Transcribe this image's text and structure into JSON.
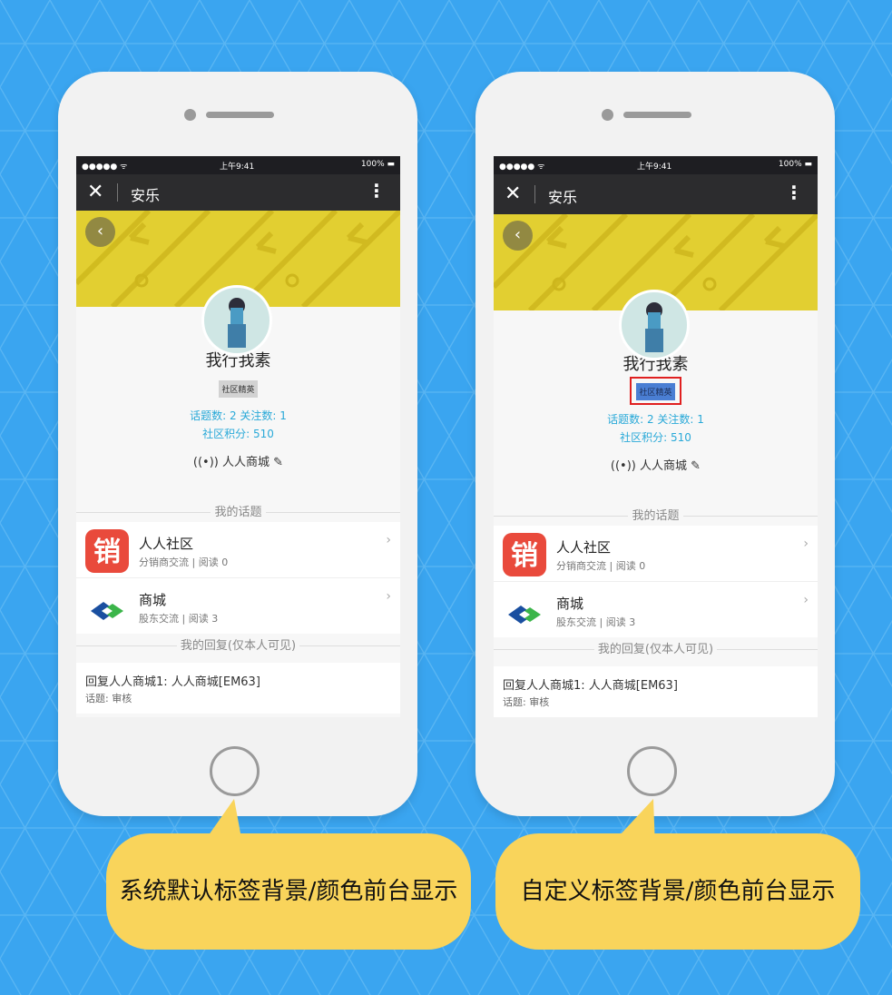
{
  "background_color": "#3aa5f0",
  "phones": [
    {
      "status_bar": {
        "signal": "●●●●● ᯤ",
        "time": "上午9:41",
        "battery": "100% ▬"
      },
      "title_bar": {
        "close": "✕",
        "title": "安乐",
        "more": "⋮"
      },
      "profile": {
        "username": "我行我素",
        "badge": "社区精英",
        "stats_line1": "话题数: 2 关注数: 1",
        "stats_line2": "社区积分: 510",
        "shop_name": "人人商城"
      },
      "my_topics_header": "我的话题",
      "topics": [
        {
          "name": "人人社区",
          "meta": "分销商交流 | 阅读 0",
          "icon_char": "销"
        },
        {
          "name": "商城",
          "meta": "股东交流 | 阅读 3",
          "icon_char": ""
        }
      ],
      "my_replies_header": "我的回复(仅本人可见)",
      "reply": {
        "title": "回复人人商城1: 人人商城[EM63]",
        "meta": "话题: 审核"
      }
    },
    {
      "status_bar": {
        "signal": "●●●●● ᯤ",
        "time": "上午9:41",
        "battery": "100% ▬"
      },
      "title_bar": {
        "close": "✕",
        "title": "安乐",
        "more": "⋮"
      },
      "profile": {
        "username": "我行我素",
        "badge": "社区精英",
        "stats_line1": "话题数: 2 关注数: 1",
        "stats_line2": "社区积分: 510",
        "shop_name": "人人商城"
      },
      "my_topics_header": "我的话题",
      "topics": [
        {
          "name": "人人社区",
          "meta": "分销商交流 | 阅读 0",
          "icon_char": "销"
        },
        {
          "name": "商城",
          "meta": "股东交流 | 阅读 3",
          "icon_char": ""
        }
      ],
      "my_replies_header": "我的回复(仅本人可见)",
      "reply": {
        "title": "回复人人商城1: 人人商城[EM63]",
        "meta": "话题: 审核"
      }
    }
  ],
  "captions": {
    "left": "系统默认标签背景/颜色前台显示",
    "right": "自定义标签背景/颜色前台显示"
  }
}
